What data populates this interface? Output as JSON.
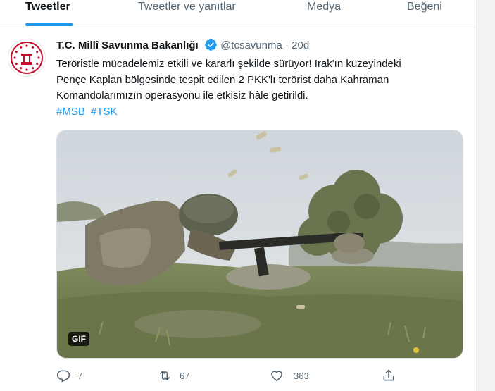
{
  "tabs": [
    {
      "label": "Tweetler",
      "active": true
    },
    {
      "label": "Tweetler ve yanıtlar",
      "active": false
    },
    {
      "label": "Medya",
      "active": false
    },
    {
      "label": "Beğeni",
      "active": false
    }
  ],
  "tweet": {
    "author_name": "T.C. Millî Savunma Bakanlığı",
    "handle": "@tcsavunma",
    "separator": "·",
    "time": "20d",
    "text_lines": [
      "Terörістle mücadelemiz etkili ve kararlı şekilde sürüyor! Irak'ın kuzeyindeki",
      "Pençe Kaplan bölgesinde tespit edilen 2 PKK'lı terörist daha Kahraman",
      "Komandolarımızın operasyonu ile etkisiz hâle getirildi."
    ],
    "hashtags": [
      "#MSB",
      "#TSK"
    ],
    "media": {
      "badge": "GIF"
    },
    "actions": {
      "replies": "7",
      "retweets": "67",
      "likes": "363"
    }
  },
  "colors": {
    "accent": "#1d9bf0",
    "text": "#0f1419",
    "muted": "#536471"
  },
  "icons": [
    "verified-badge-icon",
    "reply-icon",
    "retweet-icon",
    "like-icon",
    "share-icon"
  ]
}
